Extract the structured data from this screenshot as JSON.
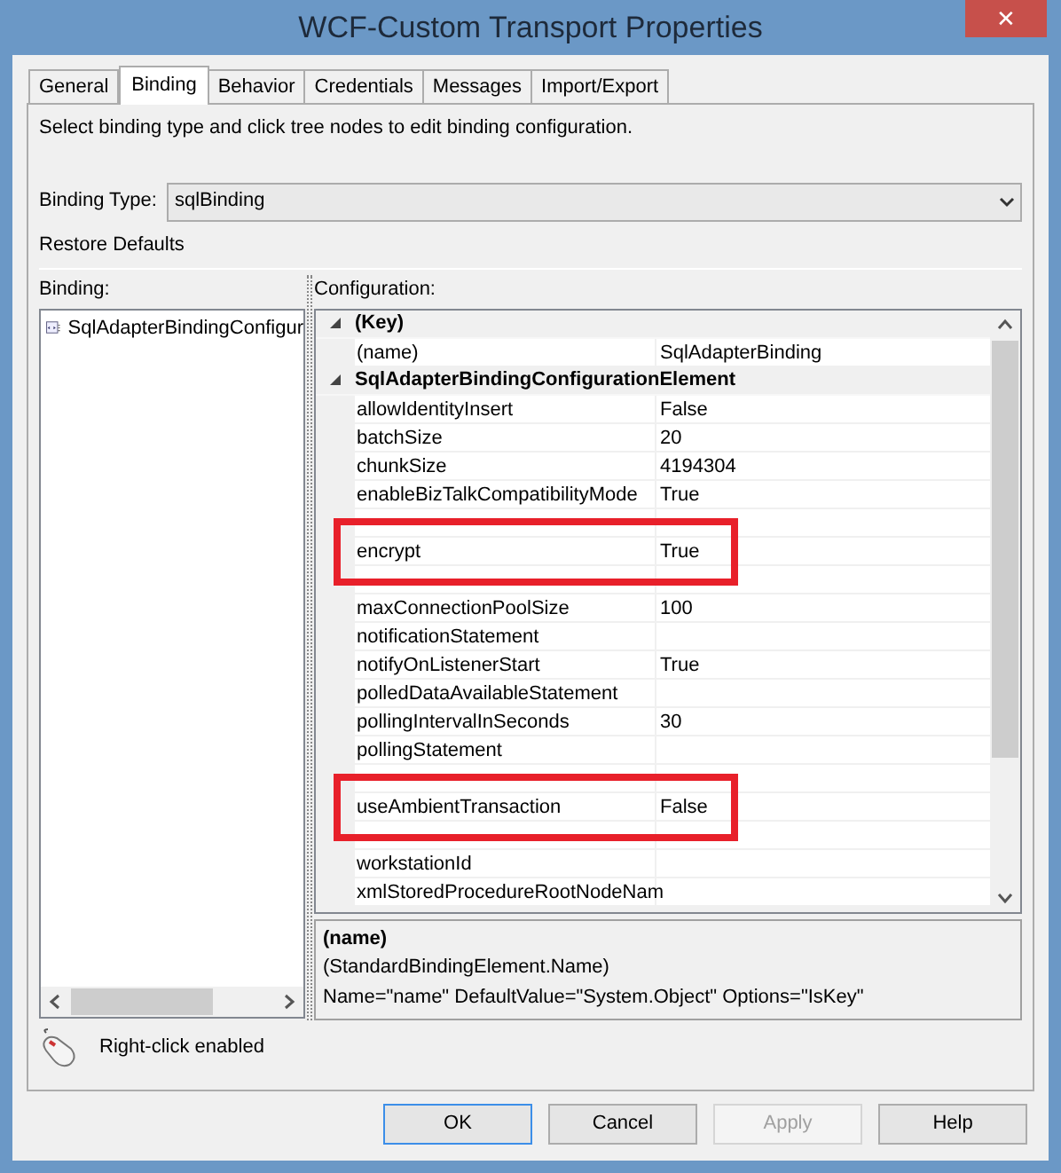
{
  "window": {
    "title": "WCF-Custom Transport Properties",
    "close": "✕"
  },
  "tabs": [
    {
      "label": "General",
      "selected": false
    },
    {
      "label": "Binding",
      "selected": true
    },
    {
      "label": "Behavior",
      "selected": false
    },
    {
      "label": "Credentials",
      "selected": false
    },
    {
      "label": "Messages",
      "selected": false
    },
    {
      "label": "Import/Export",
      "selected": false
    }
  ],
  "instructions": "Select binding type and click tree nodes to edit binding configuration.",
  "binding_type": {
    "label": "Binding Type:",
    "value": "sqlBinding"
  },
  "restore_defaults": "Restore Defaults",
  "binding_tree": {
    "label": "Binding:",
    "items": [
      {
        "label": "SqlAdapterBindingConfigur",
        "selected": false
      }
    ]
  },
  "configuration": {
    "label": "Configuration:",
    "rows": [
      {
        "kind": "category",
        "name": "(Key)"
      },
      {
        "kind": "property",
        "name": "(name)",
        "value": "SqlAdapterBinding",
        "boxed": false
      },
      {
        "kind": "category",
        "name": "SqlAdapterBindingConfigurationElement"
      },
      {
        "kind": "property",
        "name": "allowIdentityInsert",
        "value": "False",
        "boxed": false
      },
      {
        "kind": "property",
        "name": "batchSize",
        "value": "20",
        "boxed": false
      },
      {
        "kind": "property",
        "name": "chunkSize",
        "value": "4194304",
        "boxed": false
      },
      {
        "kind": "property",
        "name": "enableBizTalkCompatibilityMode",
        "value": "True",
        "boxed": false
      },
      {
        "kind": "obscured",
        "boxed": false
      },
      {
        "kind": "property",
        "name": "encrypt",
        "value": "True",
        "boxed": true
      },
      {
        "kind": "obscured",
        "boxed": false
      },
      {
        "kind": "property",
        "name": "maxConnectionPoolSize",
        "value": "100",
        "boxed": false
      },
      {
        "kind": "property",
        "name": "notificationStatement",
        "boxed": false
      },
      {
        "kind": "property",
        "name": "notifyOnListenerStart",
        "value": "True",
        "boxed": false
      },
      {
        "kind": "property",
        "name": "polledDataAvailableStatement",
        "boxed": false
      },
      {
        "kind": "property",
        "name": "pollingIntervalInSeconds",
        "value": "30",
        "boxed": false
      },
      {
        "kind": "property",
        "name": "pollingStatement",
        "boxed": false
      },
      {
        "kind": "obscured",
        "boxed": false
      },
      {
        "kind": "property",
        "name": "useAmbientTransaction",
        "value": "False",
        "boxed": true
      },
      {
        "kind": "obscured",
        "boxed": false
      },
      {
        "kind": "property",
        "name": "workstationId",
        "boxed": false
      },
      {
        "kind": "property",
        "name": "xmlStoredProcedureRootNodeNam",
        "boxed": false
      }
    ]
  },
  "description": {
    "title": "(name)",
    "lines": [
      "(StandardBindingElement.Name)",
      "Name=\"name\" DefaultValue=\"System.Object\" Options=\"IsKey\""
    ]
  },
  "hint": "Right-click enabled",
  "buttons": [
    {
      "label": "OK",
      "disabled": false,
      "default": true
    },
    {
      "label": "Cancel",
      "disabled": false,
      "default": false
    },
    {
      "label": "Apply",
      "disabled": true,
      "default": false
    },
    {
      "label": "Help",
      "disabled": false,
      "default": false
    }
  ]
}
